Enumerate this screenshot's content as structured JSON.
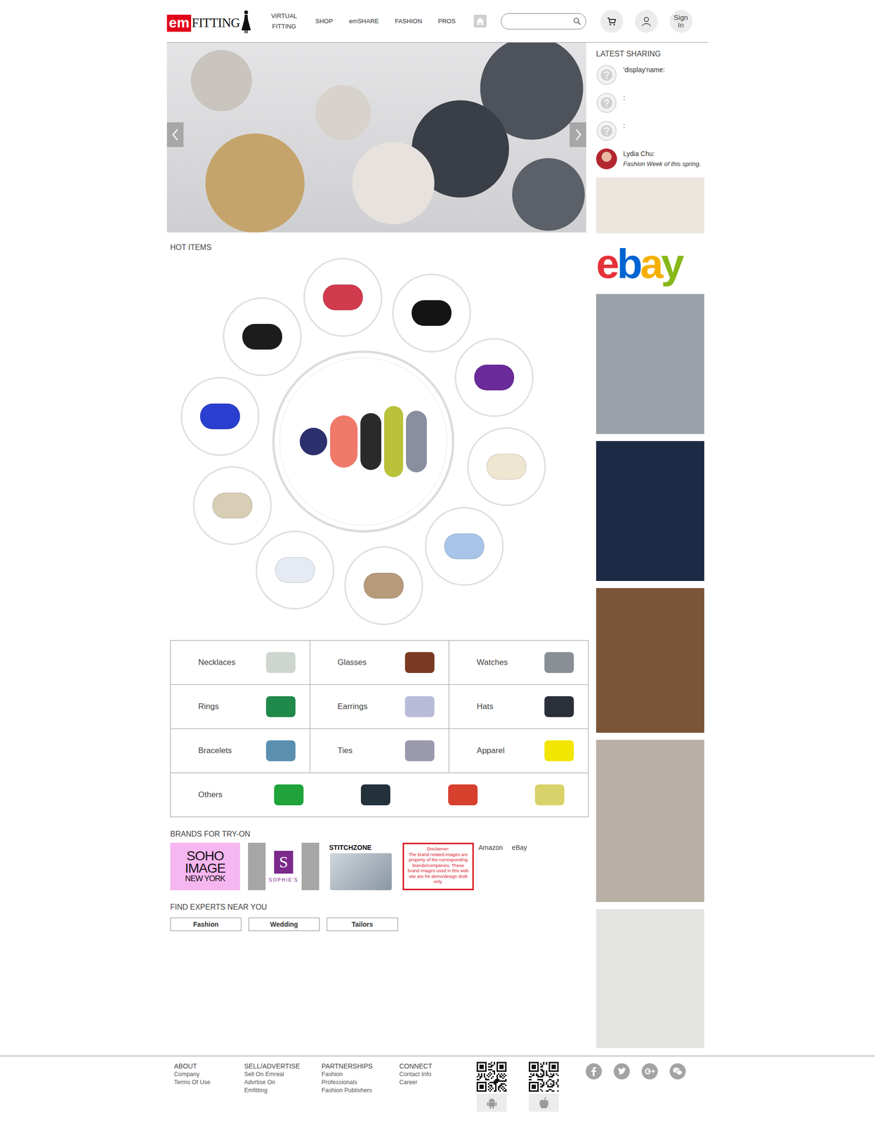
{
  "header": {
    "logo": {
      "mark": "em",
      "word": "FITTING"
    },
    "nav": [
      {
        "label": "VIRTUAL FITTING"
      },
      {
        "label": "SHOP"
      },
      {
        "label": "emSHARE"
      },
      {
        "label": "FASHION"
      },
      {
        "label": "PROS"
      }
    ],
    "search": {
      "placeholder": ""
    },
    "signIn": "Sign In"
  },
  "hotItems": {
    "title": "HOT ITEMS",
    "items": [
      {
        "color": "#d23a4e"
      },
      {
        "color": "#141414"
      },
      {
        "color": "#6a2a9a"
      },
      {
        "color": "#efe6d2"
      },
      {
        "color": "#a8c4e8"
      },
      {
        "color": "#b79a7a"
      },
      {
        "color": "#e6eaf2"
      },
      {
        "color": "#d8cdb5"
      },
      {
        "color": "#2a3fd0"
      },
      {
        "color": "#1c1c1c"
      }
    ]
  },
  "categories": {
    "cells": [
      {
        "label": "Necklaces",
        "color": "#cfd6cf"
      },
      {
        "label": "Glasses",
        "color": "#7a3a22"
      },
      {
        "label": "Watches",
        "color": "#8a8f96"
      },
      {
        "label": "Rings",
        "color": "#1f8a4a"
      },
      {
        "label": "Earrings",
        "color": "#b8bcd8"
      },
      {
        "label": "Hats",
        "color": "#2b2f3a"
      },
      {
        "label": "Bracelets",
        "color": "#5a8fb0"
      },
      {
        "label": "Ties",
        "color": "#9a9aae"
      },
      {
        "label": "Apparel",
        "color": "#f2e600"
      }
    ],
    "others": {
      "label": "Others",
      "thumbs": [
        {
          "color": "#1fa33a"
        },
        {
          "color": "#23313b"
        },
        {
          "color": "#d8402e"
        },
        {
          "color": "#d9d26a"
        }
      ]
    }
  },
  "brands": {
    "title": "BRANDS FOR TRY-ON",
    "soho": {
      "lines": [
        "SOHO",
        "IMAGE",
        "NEW YORK"
      ]
    },
    "sophie": {
      "mark": "S",
      "name": "SOPHIE'S"
    },
    "stitch": {
      "name": "STITCHZONE"
    },
    "disclaimer": {
      "title": "Disclaimer:",
      "body": "The brand related images are property of the corresponding brands/companies. These brand images used in this web site are for demo/design draft only."
    },
    "links": [
      "Amazon",
      "eBay"
    ]
  },
  "experts": {
    "title": "FIND EXPERTS NEAR YOU",
    "buttons": [
      "Fashion",
      "Wedding",
      "Tailors"
    ]
  },
  "sidebar": {
    "title": "LATEST SHARING",
    "posts": [
      {
        "name": "'display'name:",
        "text": "",
        "avatar": "placeholder"
      },
      {
        "name": ":",
        "text": "",
        "avatar": "placeholder"
      },
      {
        "name": ":",
        "text": "",
        "avatar": "placeholder"
      },
      {
        "name": "Lydia Chu:",
        "text": "Fashion Week of this spring.",
        "avatar": "photo"
      }
    ],
    "ads": [
      {
        "kind": "photo",
        "color": "#ece6df",
        "text": "",
        "letterColors": []
      },
      {
        "kind": "logo",
        "color": "#ffffff",
        "text": "ebay",
        "letterColors": [
          "#e53238",
          "#0064d2",
          "#f5af02",
          "#86b817"
        ]
      },
      {
        "kind": "photo",
        "color": "#9aa0a8",
        "text": "",
        "letterColors": []
      },
      {
        "kind": "photo",
        "color": "#1d2a45",
        "text": "",
        "letterColors": []
      },
      {
        "kind": "photo",
        "color": "#7a5538",
        "text": "",
        "letterColors": []
      },
      {
        "kind": "photo",
        "color": "#b9afa6",
        "text": "",
        "letterColors": []
      },
      {
        "kind": "photo",
        "color": "#e4e4e2",
        "text": "",
        "letterColors": []
      }
    ]
  },
  "footer": {
    "columns": [
      {
        "title": "ABOUT",
        "links": [
          "Company",
          "Terms Of Use"
        ]
      },
      {
        "title": "SELL/ADVERTISE",
        "links": [
          "Sell On Emreal",
          "Advrtise On Emfitting"
        ]
      },
      {
        "title": "PARTNERSHIPS",
        "links": [
          "Fashion",
          "Professionals",
          "Fashion Publishers"
        ]
      },
      {
        "title": "CONNECT",
        "links": [
          "Contact Info",
          "Career"
        ]
      }
    ],
    "apps": [
      {
        "kind": "android"
      },
      {
        "kind": "apple"
      }
    ]
  }
}
